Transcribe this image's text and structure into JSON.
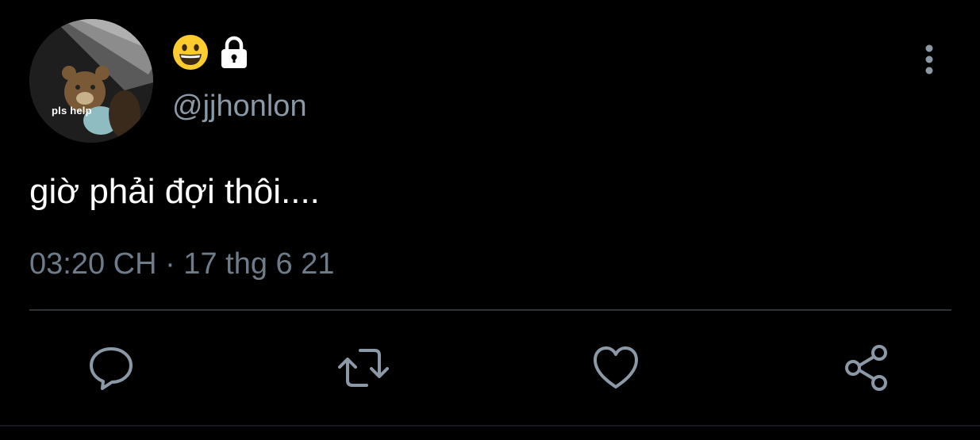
{
  "author": {
    "avatar_caption": "pls help",
    "handle": "@jjhonlon",
    "icons": [
      "grinning-face-emoji",
      "lock-icon"
    ]
  },
  "tweet": {
    "text": "giờ phải đợi thôi....",
    "timestamp": "03:20 CH · 17 thg 6 21"
  },
  "actions": [
    "reply-icon",
    "retweet-icon",
    "like-icon",
    "share-icon"
  ],
  "colors": {
    "background": "#000000",
    "text_primary": "#ffffff",
    "text_secondary": "#8b98a5",
    "icon": "#8b98a5",
    "divider": "#2f3336"
  }
}
